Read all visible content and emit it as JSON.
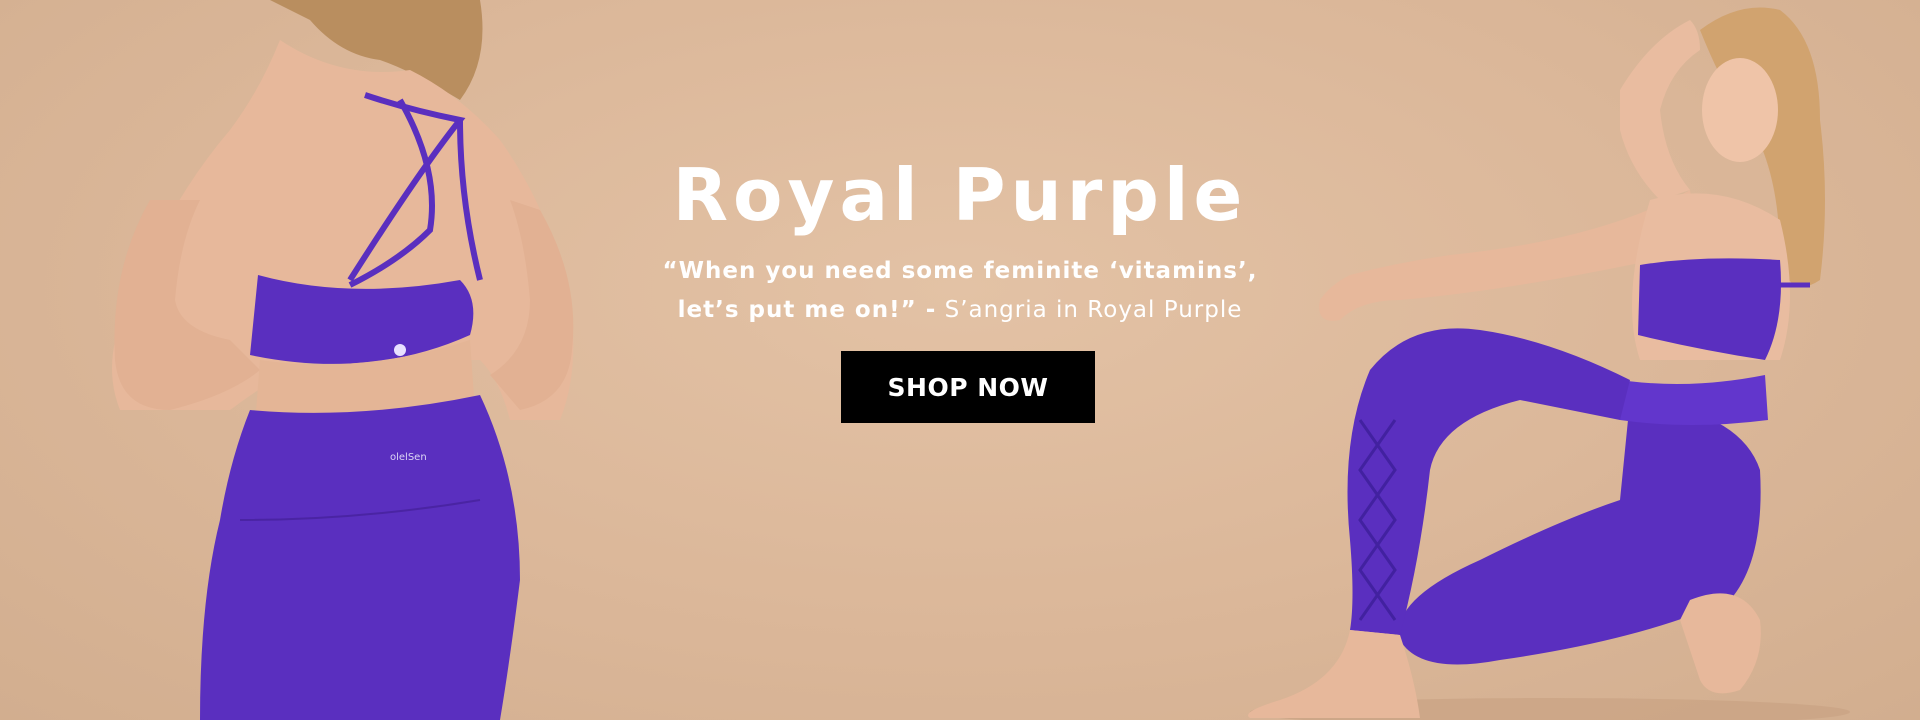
{
  "hero": {
    "title": "Royal Purple",
    "quote_bold_line1": "“When you need some feminite ‘vitamins’,",
    "quote_bold_line2": "let’s put me on!” -",
    "quote_attribution": "S’angria in Royal Purple",
    "cta_label": "SHOP NOW",
    "left_logo_text": "olelSen",
    "colors": {
      "background": "#dcb99a",
      "apparel_purple": "#5a2fbf",
      "text": "#ffffff",
      "button": "#000000"
    }
  }
}
